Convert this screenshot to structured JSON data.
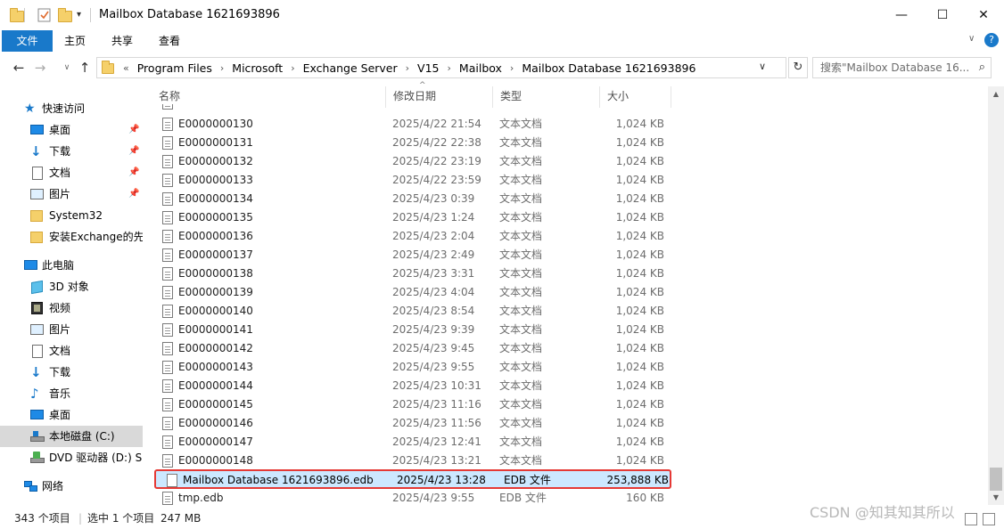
{
  "window": {
    "title": "Mailbox Database 1621693896",
    "minimize": "—",
    "maximize": "☐",
    "close": "✕"
  },
  "ribbon": {
    "tabs": [
      "文件",
      "主页",
      "共享",
      "查看"
    ]
  },
  "address": {
    "prefix": "«",
    "crumbs": [
      "Program Files",
      "Microsoft",
      "Exchange Server",
      "V15",
      "Mailbox",
      "Mailbox Database 1621693896"
    ],
    "search_placeholder": "搜索\"Mailbox Database 16..."
  },
  "nav": {
    "quick_access": "快速访问",
    "items": [
      {
        "label": "桌面",
        "icon": "desktop-icon",
        "pinned": true
      },
      {
        "label": "下载",
        "icon": "download-icon",
        "pinned": true
      },
      {
        "label": "文档",
        "icon": "document-icon",
        "pinned": true
      },
      {
        "label": "图片",
        "icon": "picture-icon",
        "pinned": true
      },
      {
        "label": "System32",
        "icon": "folder-icon",
        "pinned": false
      },
      {
        "label": "安装Exchange的先",
        "icon": "folder-icon",
        "pinned": false
      }
    ],
    "this_pc": "此电脑",
    "pc_items": [
      {
        "label": "3D 对象",
        "icon": "3d-objects-icon"
      },
      {
        "label": "视频",
        "icon": "video-icon"
      },
      {
        "label": "图片",
        "icon": "picture-icon"
      },
      {
        "label": "文档",
        "icon": "document-icon"
      },
      {
        "label": "下载",
        "icon": "download-icon"
      },
      {
        "label": "音乐",
        "icon": "music-icon"
      },
      {
        "label": "桌面",
        "icon": "desktop-icon"
      },
      {
        "label": "本地磁盘 (C:)",
        "icon": "local-disk-icon"
      },
      {
        "label": "DVD 驱动器 (D:) S",
        "icon": "dvd-drive-icon"
      }
    ],
    "network": "网络"
  },
  "columns": {
    "name": "名称",
    "date": "修改日期",
    "type": "类型",
    "size": "大小"
  },
  "files": [
    {
      "name": "E0000000130",
      "date": "2025/4/22 21:54",
      "type": "文本文档",
      "size": "1,024 KB"
    },
    {
      "name": "E0000000131",
      "date": "2025/4/22 22:38",
      "type": "文本文档",
      "size": "1,024 KB"
    },
    {
      "name": "E0000000132",
      "date": "2025/4/22 23:19",
      "type": "文本文档",
      "size": "1,024 KB"
    },
    {
      "name": "E0000000133",
      "date": "2025/4/22 23:59",
      "type": "文本文档",
      "size": "1,024 KB"
    },
    {
      "name": "E0000000134",
      "date": "2025/4/23 0:39",
      "type": "文本文档",
      "size": "1,024 KB"
    },
    {
      "name": "E0000000135",
      "date": "2025/4/23 1:24",
      "type": "文本文档",
      "size": "1,024 KB"
    },
    {
      "name": "E0000000136",
      "date": "2025/4/23 2:04",
      "type": "文本文档",
      "size": "1,024 KB"
    },
    {
      "name": "E0000000137",
      "date": "2025/4/23 2:49",
      "type": "文本文档",
      "size": "1,024 KB"
    },
    {
      "name": "E0000000138",
      "date": "2025/4/23 3:31",
      "type": "文本文档",
      "size": "1,024 KB"
    },
    {
      "name": "E0000000139",
      "date": "2025/4/23 4:04",
      "type": "文本文档",
      "size": "1,024 KB"
    },
    {
      "name": "E0000000140",
      "date": "2025/4/23 8:54",
      "type": "文本文档",
      "size": "1,024 KB"
    },
    {
      "name": "E0000000141",
      "date": "2025/4/23 9:39",
      "type": "文本文档",
      "size": "1,024 KB"
    },
    {
      "name": "E0000000142",
      "date": "2025/4/23 9:45",
      "type": "文本文档",
      "size": "1,024 KB"
    },
    {
      "name": "E0000000143",
      "date": "2025/4/23 9:55",
      "type": "文本文档",
      "size": "1,024 KB"
    },
    {
      "name": "E0000000144",
      "date": "2025/4/23 10:31",
      "type": "文本文档",
      "size": "1,024 KB"
    },
    {
      "name": "E0000000145",
      "date": "2025/4/23 11:16",
      "type": "文本文档",
      "size": "1,024 KB"
    },
    {
      "name": "E0000000146",
      "date": "2025/4/23 11:56",
      "type": "文本文档",
      "size": "1,024 KB"
    },
    {
      "name": "E0000000147",
      "date": "2025/4/23 12:41",
      "type": "文本文档",
      "size": "1,024 KB"
    },
    {
      "name": "E0000000148",
      "date": "2025/4/23 13:21",
      "type": "文本文档",
      "size": "1,024 KB"
    },
    {
      "name": "Mailbox Database 1621693896.edb",
      "date": "2025/4/23 13:28",
      "type": "EDB 文件",
      "size": "253,888 KB",
      "selected": true
    },
    {
      "name": "tmp.edb",
      "date": "2025/4/23 9:55",
      "type": "EDB 文件",
      "size": "160 KB"
    }
  ],
  "status": {
    "count": "343 个项目",
    "selected": "选中 1 个项目",
    "size": "247 MB"
  },
  "watermark": "CSDN @知其知其所以",
  "colors": {
    "accent": "#1979ca",
    "selection": "#cce8ff",
    "highlight_border": "#e53935"
  }
}
